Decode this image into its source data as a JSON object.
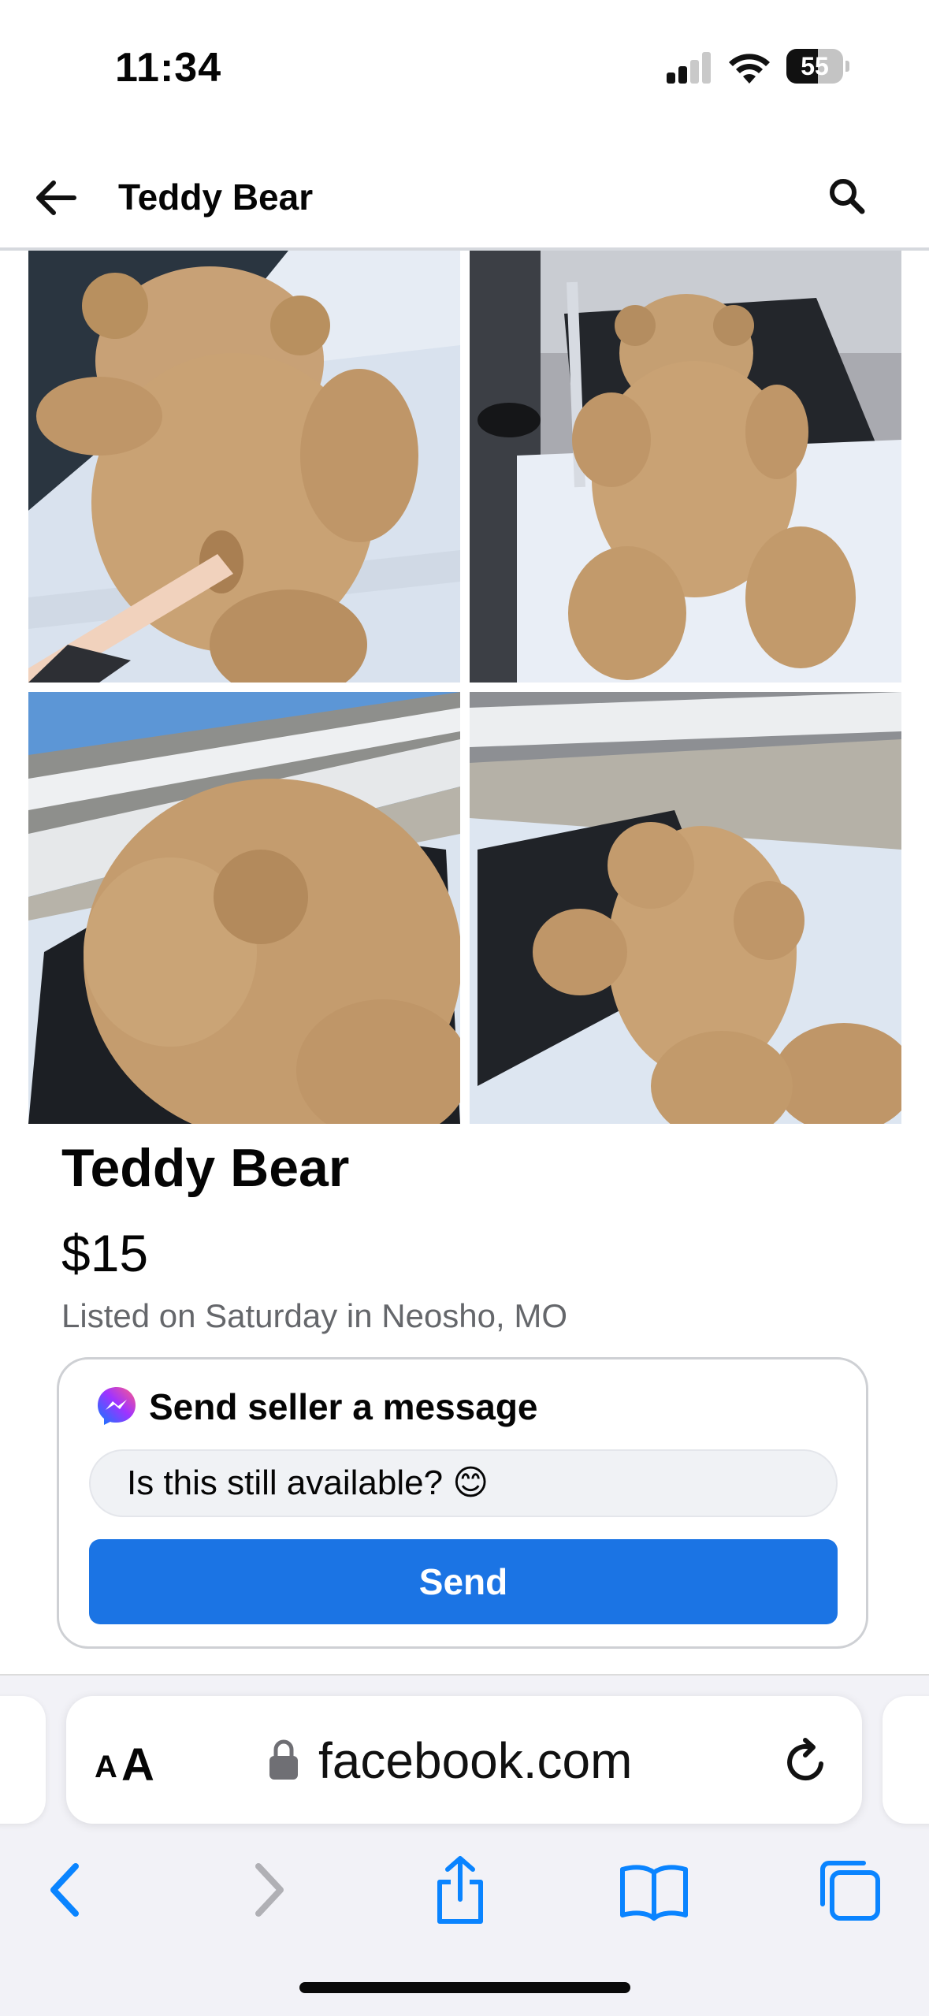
{
  "status_bar": {
    "time": "11:34",
    "battery_percent": "55"
  },
  "header": {
    "title": "Teddy Bear"
  },
  "photos": [
    {
      "alt": "teddy-bear-photo-1"
    },
    {
      "alt": "teddy-bear-photo-2"
    },
    {
      "alt": "teddy-bear-photo-3"
    },
    {
      "alt": "teddy-bear-photo-4"
    }
  ],
  "listing": {
    "title": "Teddy Bear",
    "price": "$15",
    "meta": "Listed on Saturday in Neosho, MO"
  },
  "message_card": {
    "heading": "Send seller a message",
    "input_value": "Is this still available? 😊",
    "send_label": "Send"
  },
  "browser": {
    "text_size_small": "A",
    "text_size_big": "A",
    "url": "facebook.com"
  },
  "colors": {
    "accent": "#1b74e4",
    "ios_blue": "#0a84ff",
    "text_secondary": "#65676b"
  }
}
